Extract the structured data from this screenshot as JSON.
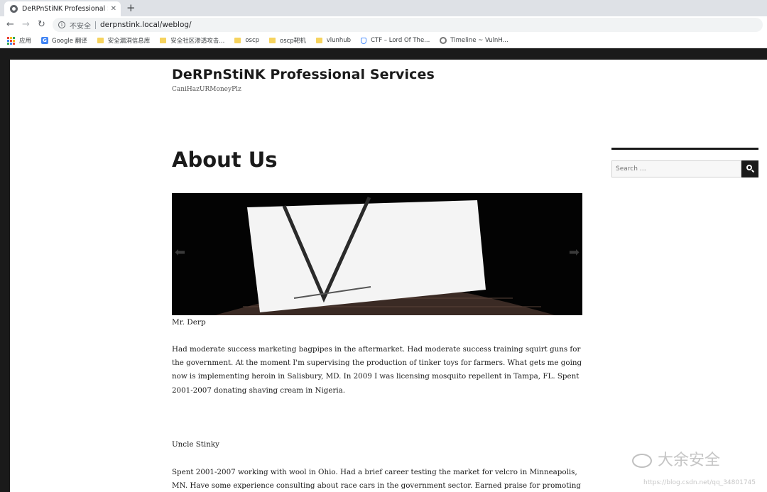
{
  "browser": {
    "tab_title": "DeRPnStiNK Professional Servi",
    "tab_close": "✕",
    "new_tab": "+",
    "security_label": "不安全",
    "url": "derpnstink.local/weblog/"
  },
  "bookmarks": [
    {
      "label": "应用",
      "icon": "apps-icon"
    },
    {
      "label": "Google 翻译",
      "icon": "google-translate-icon"
    },
    {
      "label": "安全漏洞信息库",
      "icon": "folder-icon"
    },
    {
      "label": "安全社区渗透攻击...",
      "icon": "folder-icon"
    },
    {
      "label": "oscp",
      "icon": "folder-icon"
    },
    {
      "label": "oscp靶机",
      "icon": "folder-icon"
    },
    {
      "label": "vlunhub",
      "icon": "folder-icon"
    },
    {
      "label": "CTF – Lord Of The...",
      "icon": "shield-icon"
    },
    {
      "label": "Timeline ~ VulnH...",
      "icon": "gear-icon"
    }
  ],
  "site": {
    "title": "DeRPnStiNK Professional Services",
    "description": "CaniHazURMoneyPlz"
  },
  "entry": {
    "title": "About Us",
    "slider": {
      "prev": "⬅",
      "next": "➡"
    },
    "caption": "Mr. Derp",
    "paragraph1": "Had moderate success marketing bagpipes in the aftermarket. Had moderate success training squirt guns for the government. At the moment I'm supervising the production of tinker toys for farmers. What gets me going now is implementing heroin in Salisbury, MD. In 2009 I was licensing mosquito repellent in Tampa, FL. Spent 2001-2007 donating shaving cream in Nigeria.",
    "heading2": "Uncle Stinky",
    "paragraph2": "Spent 2001-2007 working with wool in Ohio. Had a brief career testing the market for velcro in Minneapolis, MN. Have some experience consulting about race cars in the government sector. Earned praise for promoting toy monkeys"
  },
  "sidebar": {
    "search_placeholder": "Search …"
  },
  "watermark": {
    "text": "大余安全",
    "url": "https://blog.csdn.net/qq_34801745"
  }
}
